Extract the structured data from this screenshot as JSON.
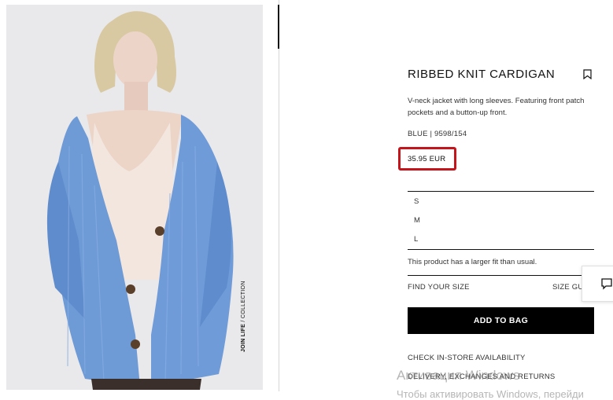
{
  "product": {
    "title": "RIBBED KNIT CARDIGAN",
    "description": "V-neck jacket with long sleeves. Featuring front patch pockets and a button-up front.",
    "color_ref": "BLUE | 9598/154",
    "price": "35.95 EUR",
    "sizes": [
      "S",
      "M",
      "L"
    ],
    "fit_note": "This product has a larger fit than usual.",
    "find_size": "FIND YOUR SIZE",
    "size_guide": "SIZE GU",
    "add_to_bag": "ADD TO BAG",
    "links": {
      "store": "CHECK IN-STORE AVAILABILITY",
      "delivery": "DELIVERY, EXCHANGES AND RETURNS"
    }
  },
  "photo": {
    "tag_bold": "JOIN LIFE",
    "tag_rest": " / COLLECTION"
  },
  "watermark": {
    "line1": "Активация Windows",
    "line2": "Чтобы активировать Windows, перейди"
  },
  "colors": {
    "highlight": "#c4141c",
    "cardigan": "#6e9ad6",
    "button": "#000000"
  },
  "icons": {
    "bookmark": "bookmark-icon",
    "chat": "chat-bubble-icon"
  }
}
